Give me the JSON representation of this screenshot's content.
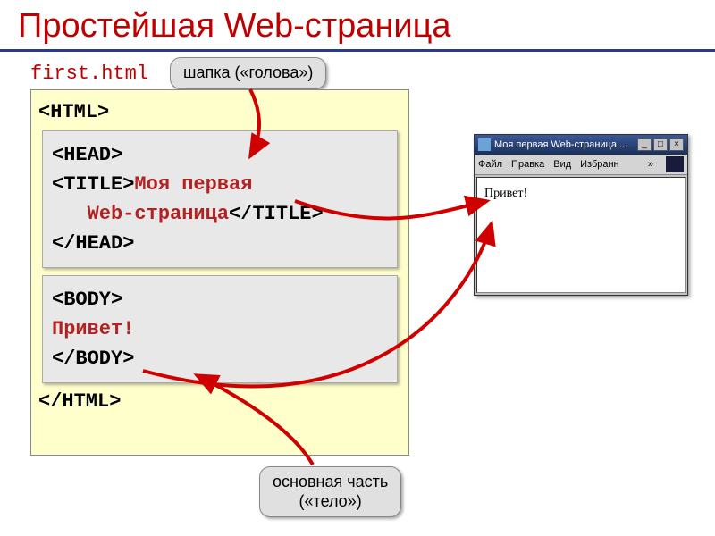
{
  "title": "Простейшая Web-страница",
  "filename": "first.html",
  "callouts": {
    "head": "шапка («голова»)",
    "body_line1": "основная часть",
    "body_line2": "(«тело»)"
  },
  "code": {
    "html_open": "<HTML>",
    "html_close": "</HTML>",
    "head_open": "<HEAD>",
    "title_open": "<TITLE>",
    "title_text_line1": "Моя первая",
    "title_text_line2_indent": "   Web-страница",
    "title_close": "</TITLE>",
    "head_close": "</HEAD>",
    "body_open": "<BODY>",
    "body_text": "Привет!",
    "body_close": "</BODY>"
  },
  "browser": {
    "title": "Моя первая Web-страница ...",
    "menu": {
      "file": "Файл",
      "edit": "Правка",
      "view": "Вид",
      "fav": "Избранн",
      "more": "»"
    },
    "content": "Привет!",
    "btn_min": "_",
    "btn_max": "□",
    "btn_close": "×"
  }
}
